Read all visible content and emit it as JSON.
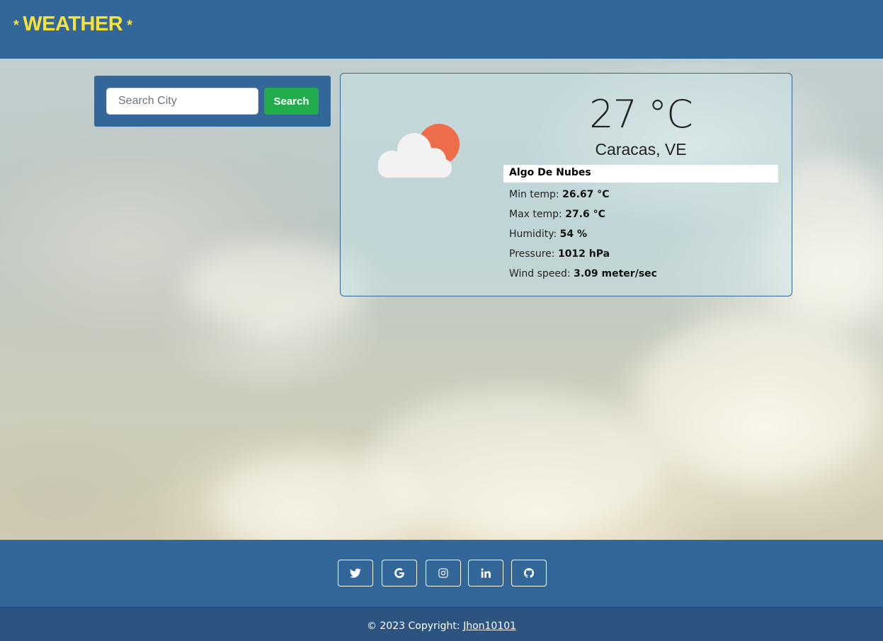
{
  "header": {
    "brand_star_left": "*",
    "brand_title": "WEATHER",
    "brand_star_right": "*"
  },
  "search": {
    "placeholder": "Search City",
    "button_label": "Search"
  },
  "weather": {
    "icon": "cloud-sun-icon",
    "temperature": "27 °C",
    "location": "Caracas, VE",
    "description": "Algo De Nubes",
    "stats": [
      {
        "label": "Min temp:",
        "value": "26.67 °C"
      },
      {
        "label": "Max temp:",
        "value": "27.6 °C"
      },
      {
        "label": "Humidity:",
        "value": "54 %"
      },
      {
        "label": "Pressure:",
        "value": "1012 hPa"
      },
      {
        "label": "Wind speed:",
        "value": "3.09 meter/sec"
      }
    ]
  },
  "social": {
    "icons": [
      "twitter-icon",
      "google-icon",
      "instagram-icon",
      "linkedin-icon",
      "github-icon"
    ]
  },
  "footer": {
    "copyright_text": "© 2023 Copyright: ",
    "author_link": "Jhon10101"
  },
  "colors": {
    "header_bg": "#336699",
    "brand": "#f5e33a",
    "search_button": "#22ad4c",
    "footer_bg": "#2b5480"
  }
}
